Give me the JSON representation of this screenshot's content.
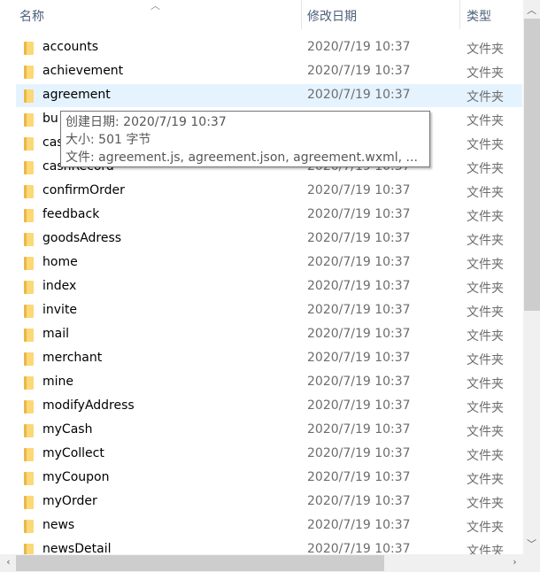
{
  "columns": {
    "name": "名称",
    "date": "修改日期",
    "type": "类型"
  },
  "rows": [
    {
      "name": "accounts",
      "date": "2020/7/19 10:37",
      "type": "文件夹"
    },
    {
      "name": "achievement",
      "date": "2020/7/19 10:37",
      "type": "文件夹"
    },
    {
      "name": "agreement",
      "date": "2020/7/19 10:37",
      "type": "文件夹",
      "selected": true
    },
    {
      "name": "bu",
      "date": "",
      "type": "文件夹"
    },
    {
      "name": "cas",
      "date": "",
      "type": "文件夹"
    },
    {
      "name": "cashRecord",
      "date": "2020/7/19 10:37",
      "type": "文件夹"
    },
    {
      "name": "confirmOrder",
      "date": "2020/7/19 10:37",
      "type": "文件夹"
    },
    {
      "name": "feedback",
      "date": "2020/7/19 10:37",
      "type": "文件夹"
    },
    {
      "name": "goodsAdress",
      "date": "2020/7/19 10:37",
      "type": "文件夹"
    },
    {
      "name": "home",
      "date": "2020/7/19 10:37",
      "type": "文件夹"
    },
    {
      "name": "index",
      "date": "2020/7/19 10:37",
      "type": "文件夹"
    },
    {
      "name": "invite",
      "date": "2020/7/19 10:37",
      "type": "文件夹"
    },
    {
      "name": "mail",
      "date": "2020/7/19 10:37",
      "type": "文件夹"
    },
    {
      "name": "merchant",
      "date": "2020/7/19 10:37",
      "type": "文件夹"
    },
    {
      "name": "mine",
      "date": "2020/7/19 10:37",
      "type": "文件夹"
    },
    {
      "name": "modifyAddress",
      "date": "2020/7/19 10:37",
      "type": "文件夹"
    },
    {
      "name": "myCash",
      "date": "2020/7/19 10:37",
      "type": "文件夹"
    },
    {
      "name": "myCollect",
      "date": "2020/7/19 10:37",
      "type": "文件夹"
    },
    {
      "name": "myCoupon",
      "date": "2020/7/19 10:37",
      "type": "文件夹"
    },
    {
      "name": "myOrder",
      "date": "2020/7/19 10:37",
      "type": "文件夹"
    },
    {
      "name": "news",
      "date": "2020/7/19 10:37",
      "type": "文件夹"
    },
    {
      "name": "newsDetail",
      "date": "2020/7/19 10:37",
      "type": "文件夹"
    }
  ],
  "tooltip": {
    "created": "创建日期: 2020/7/19 10:37",
    "size": "大小: 501 字节",
    "files": "文件: agreement.js, agreement.json, agreement.wxml, ..."
  },
  "icons": {
    "folder": "folder-icon",
    "sort": "sort-ascending-icon"
  },
  "colors": {
    "selection": "#e5f3ff",
    "header_text": "#4c607a"
  }
}
